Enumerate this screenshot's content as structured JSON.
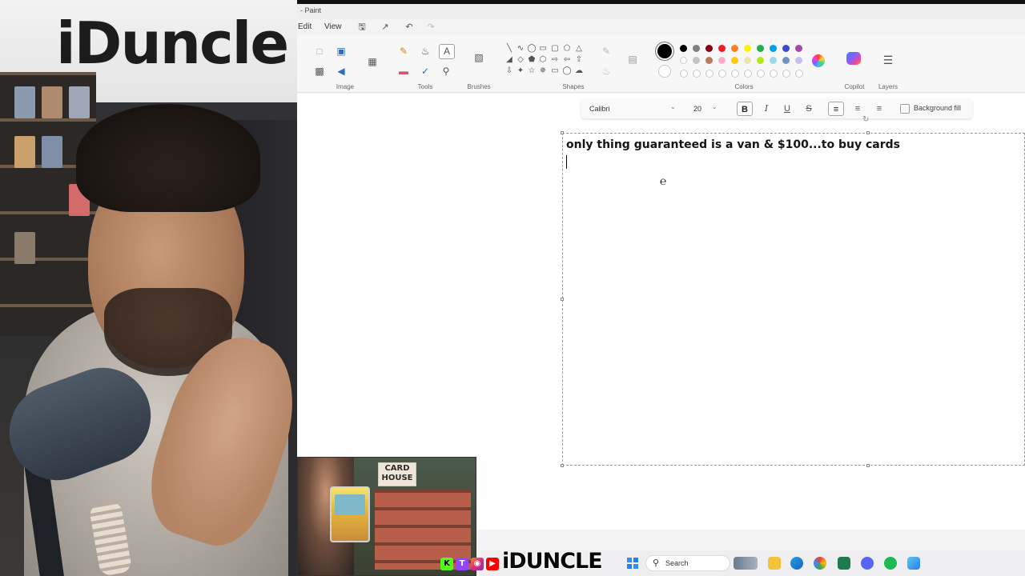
{
  "app": {
    "window_title": "- Paint"
  },
  "menu": {
    "edit": "Edit",
    "view": "View"
  },
  "ribbon": {
    "groups": {
      "image": "Image",
      "tools": "Tools",
      "brushes": "Brushes",
      "shapes": "Shapes",
      "colors": "Colors",
      "copilot": "Copilot",
      "layers": "Layers"
    },
    "primary_color": "#000000",
    "secondary_color": "#ffffff",
    "palette_row1": [
      "#000000",
      "#7f7f7f",
      "#880015",
      "#ed1c24",
      "#ff7f27",
      "#fff200",
      "#22b14c",
      "#00a2e8",
      "#3f48cc",
      "#a349a4"
    ],
    "palette_row2": [
      "#ffffff",
      "#c3c3c3",
      "#b97a57",
      "#ffaec9",
      "#ffc90e",
      "#efe4b0",
      "#b5e61d",
      "#99d9ea",
      "#7092be",
      "#c8bfe7"
    ]
  },
  "text_toolbar": {
    "font": "Calibri",
    "size": "20",
    "bold": "B",
    "italic": "I",
    "underline": "U",
    "strike": "S",
    "background_fill": "Background fill"
  },
  "canvas": {
    "text": "only thing guaranteed is a van & $100...to buy cards"
  },
  "webcam": {
    "sign_text": "iDuncle"
  },
  "overlay": {
    "sign_text": "CARD HOUSE"
  },
  "taskbar": {
    "search_placeholder": "Search"
  },
  "branding": {
    "channel_name": "iDUNCLE",
    "social_icons": [
      "kick-icon",
      "twitch-icon",
      "instagram-icon",
      "youtube-icon"
    ]
  }
}
